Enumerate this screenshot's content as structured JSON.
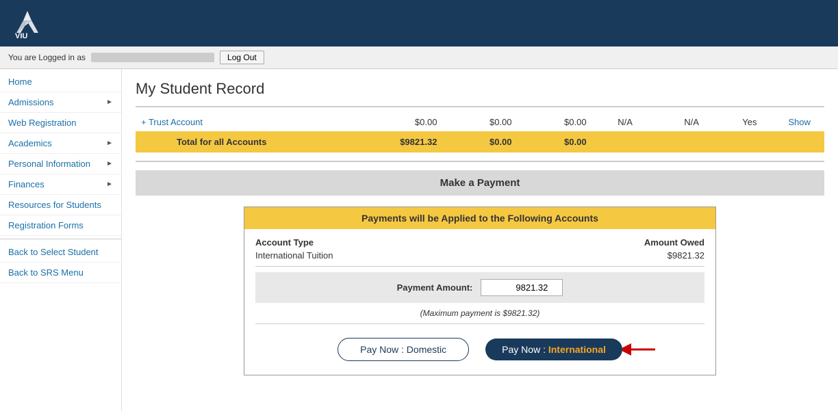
{
  "header": {
    "logo_alt": "VIU Logo"
  },
  "topbar": {
    "logged_in_text": "You are Logged in as",
    "username": "██████████████████",
    "logout_label": "Log Out"
  },
  "sidebar": {
    "items": [
      {
        "label": "Home",
        "has_arrow": false
      },
      {
        "label": "Admissions",
        "has_arrow": true
      },
      {
        "label": "Web Registration",
        "has_arrow": false
      },
      {
        "label": "Academics",
        "has_arrow": true
      },
      {
        "label": "Personal Information",
        "has_arrow": true
      },
      {
        "label": "Finances",
        "has_arrow": true
      },
      {
        "label": "Resources for Students",
        "has_arrow": false
      },
      {
        "label": "Registration Forms",
        "has_arrow": false
      },
      {
        "label": "Back to Select Student",
        "has_arrow": false
      },
      {
        "label": "Back to SRS Menu",
        "has_arrow": false
      }
    ]
  },
  "main": {
    "page_title": "My Student Record",
    "trust_account_label": "+ Trust Account",
    "trust_values": [
      "$0.00",
      "$0.00",
      "$0.00",
      "N/A",
      "N/A",
      "Yes",
      "Show"
    ],
    "total_label": "Total for all Accounts",
    "total_values": [
      "$9821.32",
      "$0.00",
      "$0.00"
    ],
    "payment_section_title": "Make a Payment",
    "payment_box_header": "Payments will be Applied to the Following Accounts",
    "account_type_col": "Account Type",
    "amount_owed_col": "Amount Owed",
    "account_name": "International Tuition",
    "account_amount": "$9821.32",
    "payment_amount_label": "Payment Amount:",
    "payment_amount_value": "9821.32",
    "max_payment_text": "(Maximum payment is $9821.32)",
    "btn_domestic": "Pay Now : Domestic",
    "btn_international_prefix": "Pay Now : ",
    "btn_international_suffix": "International"
  }
}
